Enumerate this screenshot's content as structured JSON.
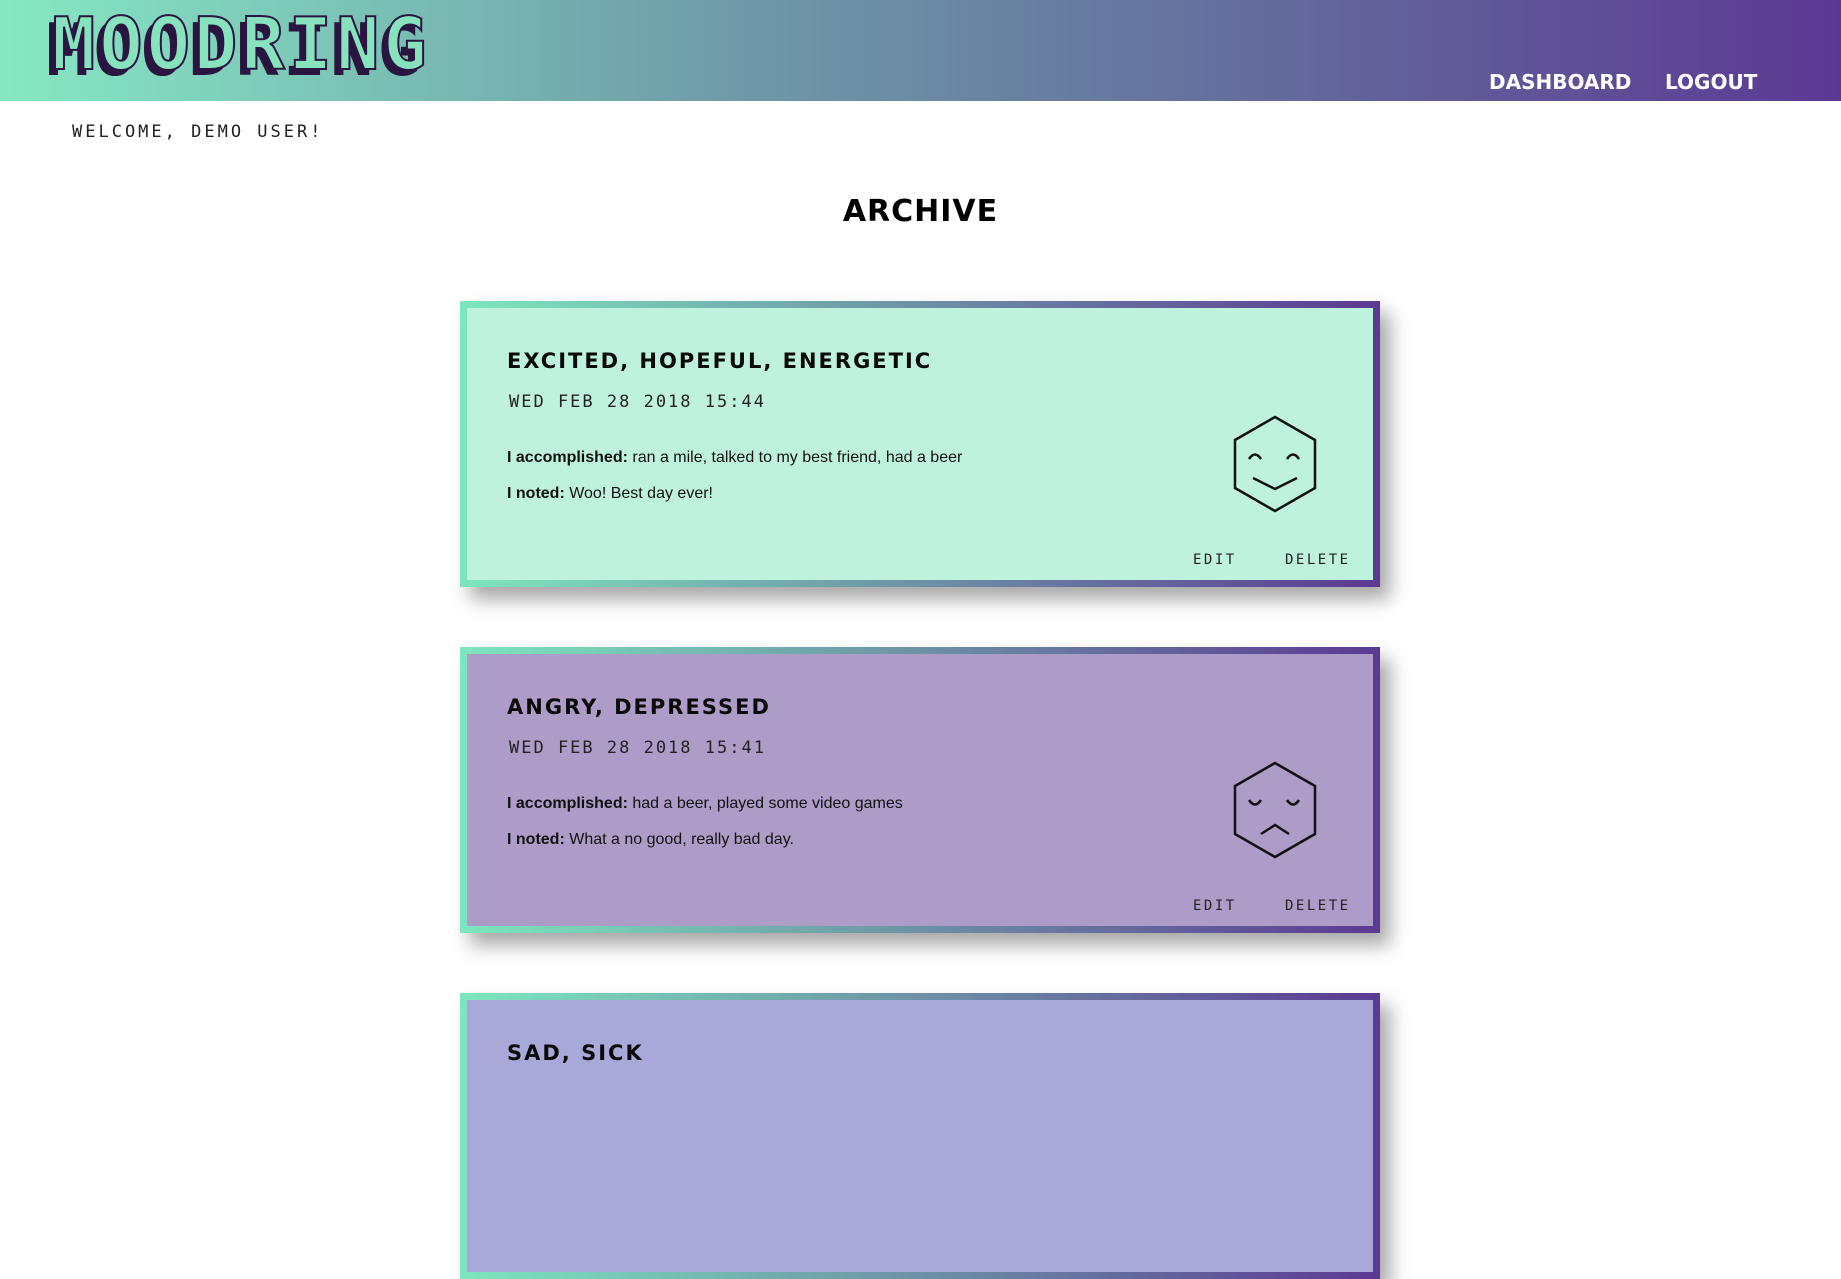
{
  "header": {
    "logo": "MOODRING",
    "nav": {
      "dashboard": "DASHBOARD",
      "logout": "LOGOUT"
    }
  },
  "welcome": "WELCOME, DEMO USER!",
  "page_title": "ARCHIVE",
  "labels": {
    "accomplished": "I accomplished:",
    "noted": "I noted:",
    "edit": "EDIT",
    "delete": "DELETE"
  },
  "entries": [
    {
      "moods": "EXCITED, HOPEFUL, ENERGETIC",
      "date": "WED FEB 28 2018 15:44",
      "accomplished": "ran a mile, talked to my best friend, had a beer",
      "noted": "Woo! Best day ever!",
      "face": "happy-face-icon",
      "color": "#bff2dc"
    },
    {
      "moods": "ANGRY, DEPRESSED",
      "date": "WED FEB 28 2018 15:41",
      "accomplished": "had a beer, played some video games",
      "noted": "What a no good, really bad day.",
      "face": "sad-face-icon",
      "color": "#ad9bc8"
    },
    {
      "moods": "SAD, SICK",
      "color": "#a8a9d8"
    }
  ],
  "colors": {
    "header_gradient_start": "#86e8c3",
    "header_gradient_end": "#5b3993",
    "logo_fill": "#86e3bd",
    "logo_shadow": "#2a1440"
  }
}
